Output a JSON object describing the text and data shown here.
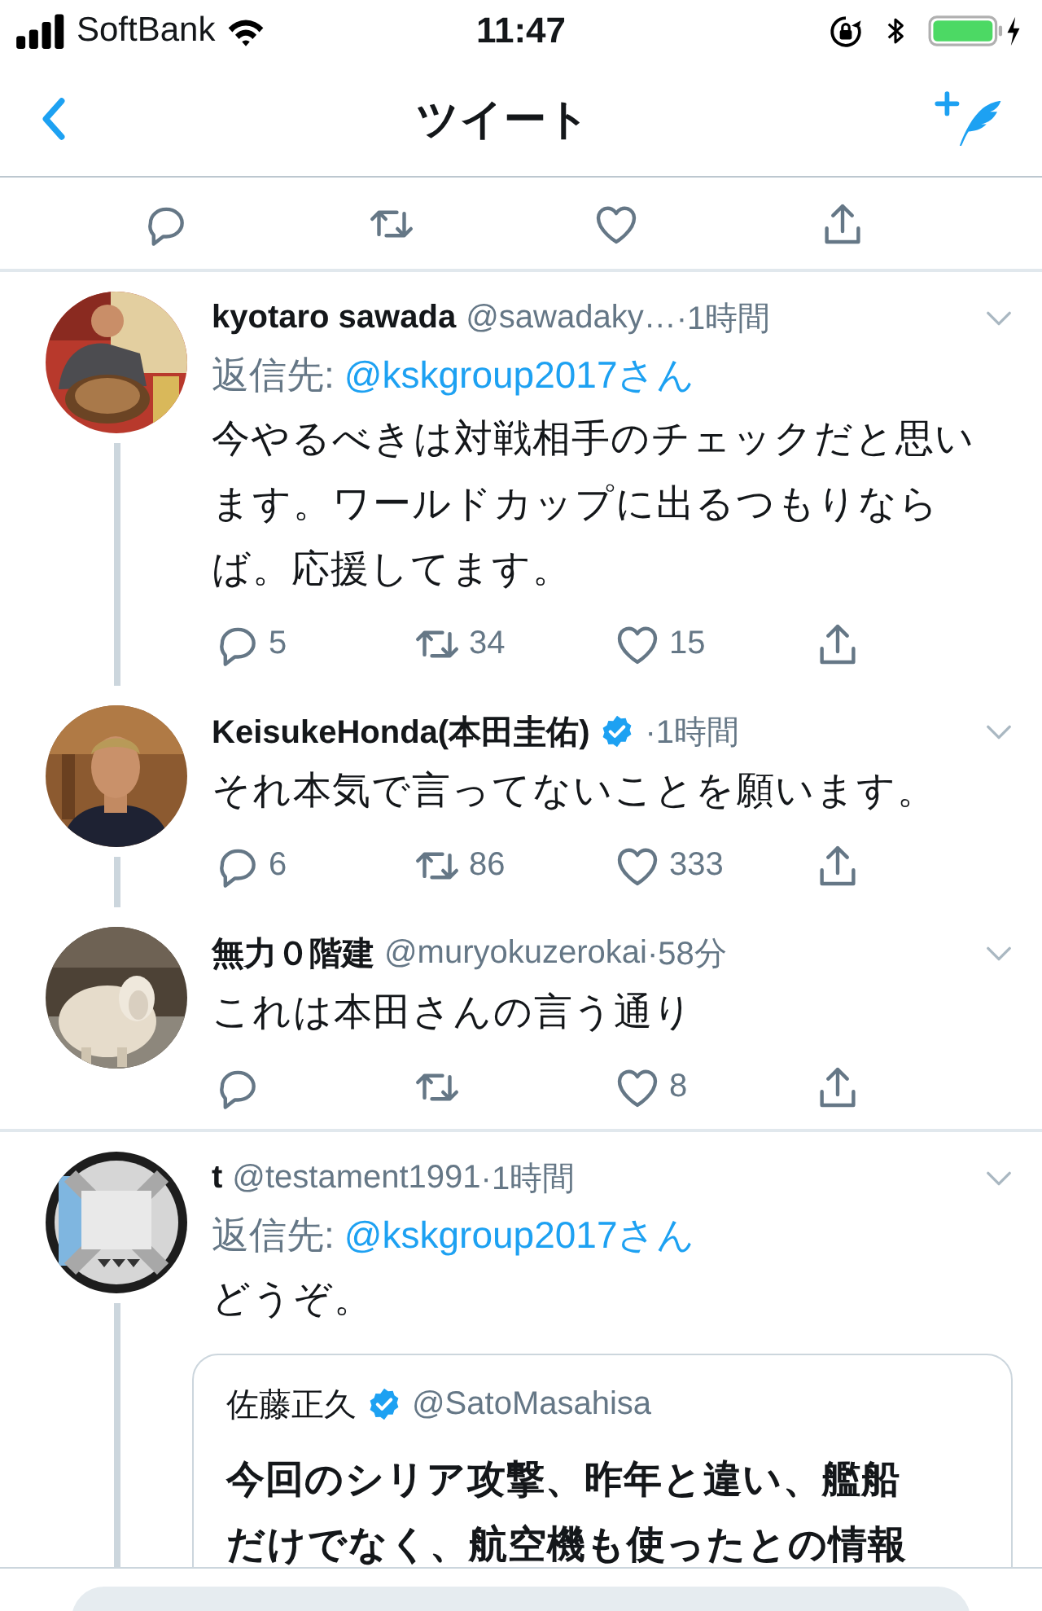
{
  "status_bar": {
    "carrier": "SoftBank",
    "time": "11:47"
  },
  "nav_bar": {
    "title": "ツイート"
  },
  "top_actions": [
    {
      "kind": "reply"
    },
    {
      "kind": "retweet"
    },
    {
      "kind": "like"
    },
    {
      "kind": "share"
    }
  ],
  "conversations": [
    {
      "tweets": [
        {
          "name": "kyotaro sawada",
          "verified": false,
          "handle": "@sawadaky…",
          "time": "·1時間",
          "reply_to": {
            "label": "返信先:",
            "user": "@kskgroup2017さん"
          },
          "text": "今やるべきは対戦相手のチェックだと思います。ワールドカップに出るつもりならば。応援してます。",
          "thread_line": true,
          "actions": [
            {
              "kind": "reply",
              "count": "5"
            },
            {
              "kind": "retweet",
              "count": "34"
            },
            {
              "kind": "like",
              "count": "15"
            },
            {
              "kind": "share"
            }
          ]
        },
        {
          "name": "KeisukeHonda(本田圭佑)",
          "verified": true,
          "time": "·1時間",
          "text": "それ本気で言ってないことを願います。",
          "thread_line": true,
          "actions": [
            {
              "kind": "reply",
              "count": "6"
            },
            {
              "kind": "retweet",
              "count": "86"
            },
            {
              "kind": "like",
              "count": "333"
            },
            {
              "kind": "share"
            }
          ]
        },
        {
          "name": "無力０階建",
          "verified": false,
          "handle": "@muryokuzerokai",
          "time": "·58分",
          "text": "これは本田さんの言う通り",
          "thread_line": false,
          "actions": [
            {
              "kind": "reply"
            },
            {
              "kind": "retweet"
            },
            {
              "kind": "like",
              "count": "8"
            },
            {
              "kind": "share"
            }
          ]
        }
      ]
    },
    {
      "tweets": [
        {
          "name": "t",
          "verified": false,
          "handle": "@testament1991",
          "time": "·1時間",
          "reply_to": {
            "label": "返信先:",
            "user": "@kskgroup2017さん"
          },
          "text": "どうぞ。",
          "thread_line": true,
          "quote": {
            "name": "佐藤正久",
            "verified": true,
            "handle": "@SatoMasahisa",
            "text": "今回のシリア攻撃、昨年と違い、艦船だけでなく、航空機も使ったとの情報"
          }
        }
      ]
    }
  ]
}
